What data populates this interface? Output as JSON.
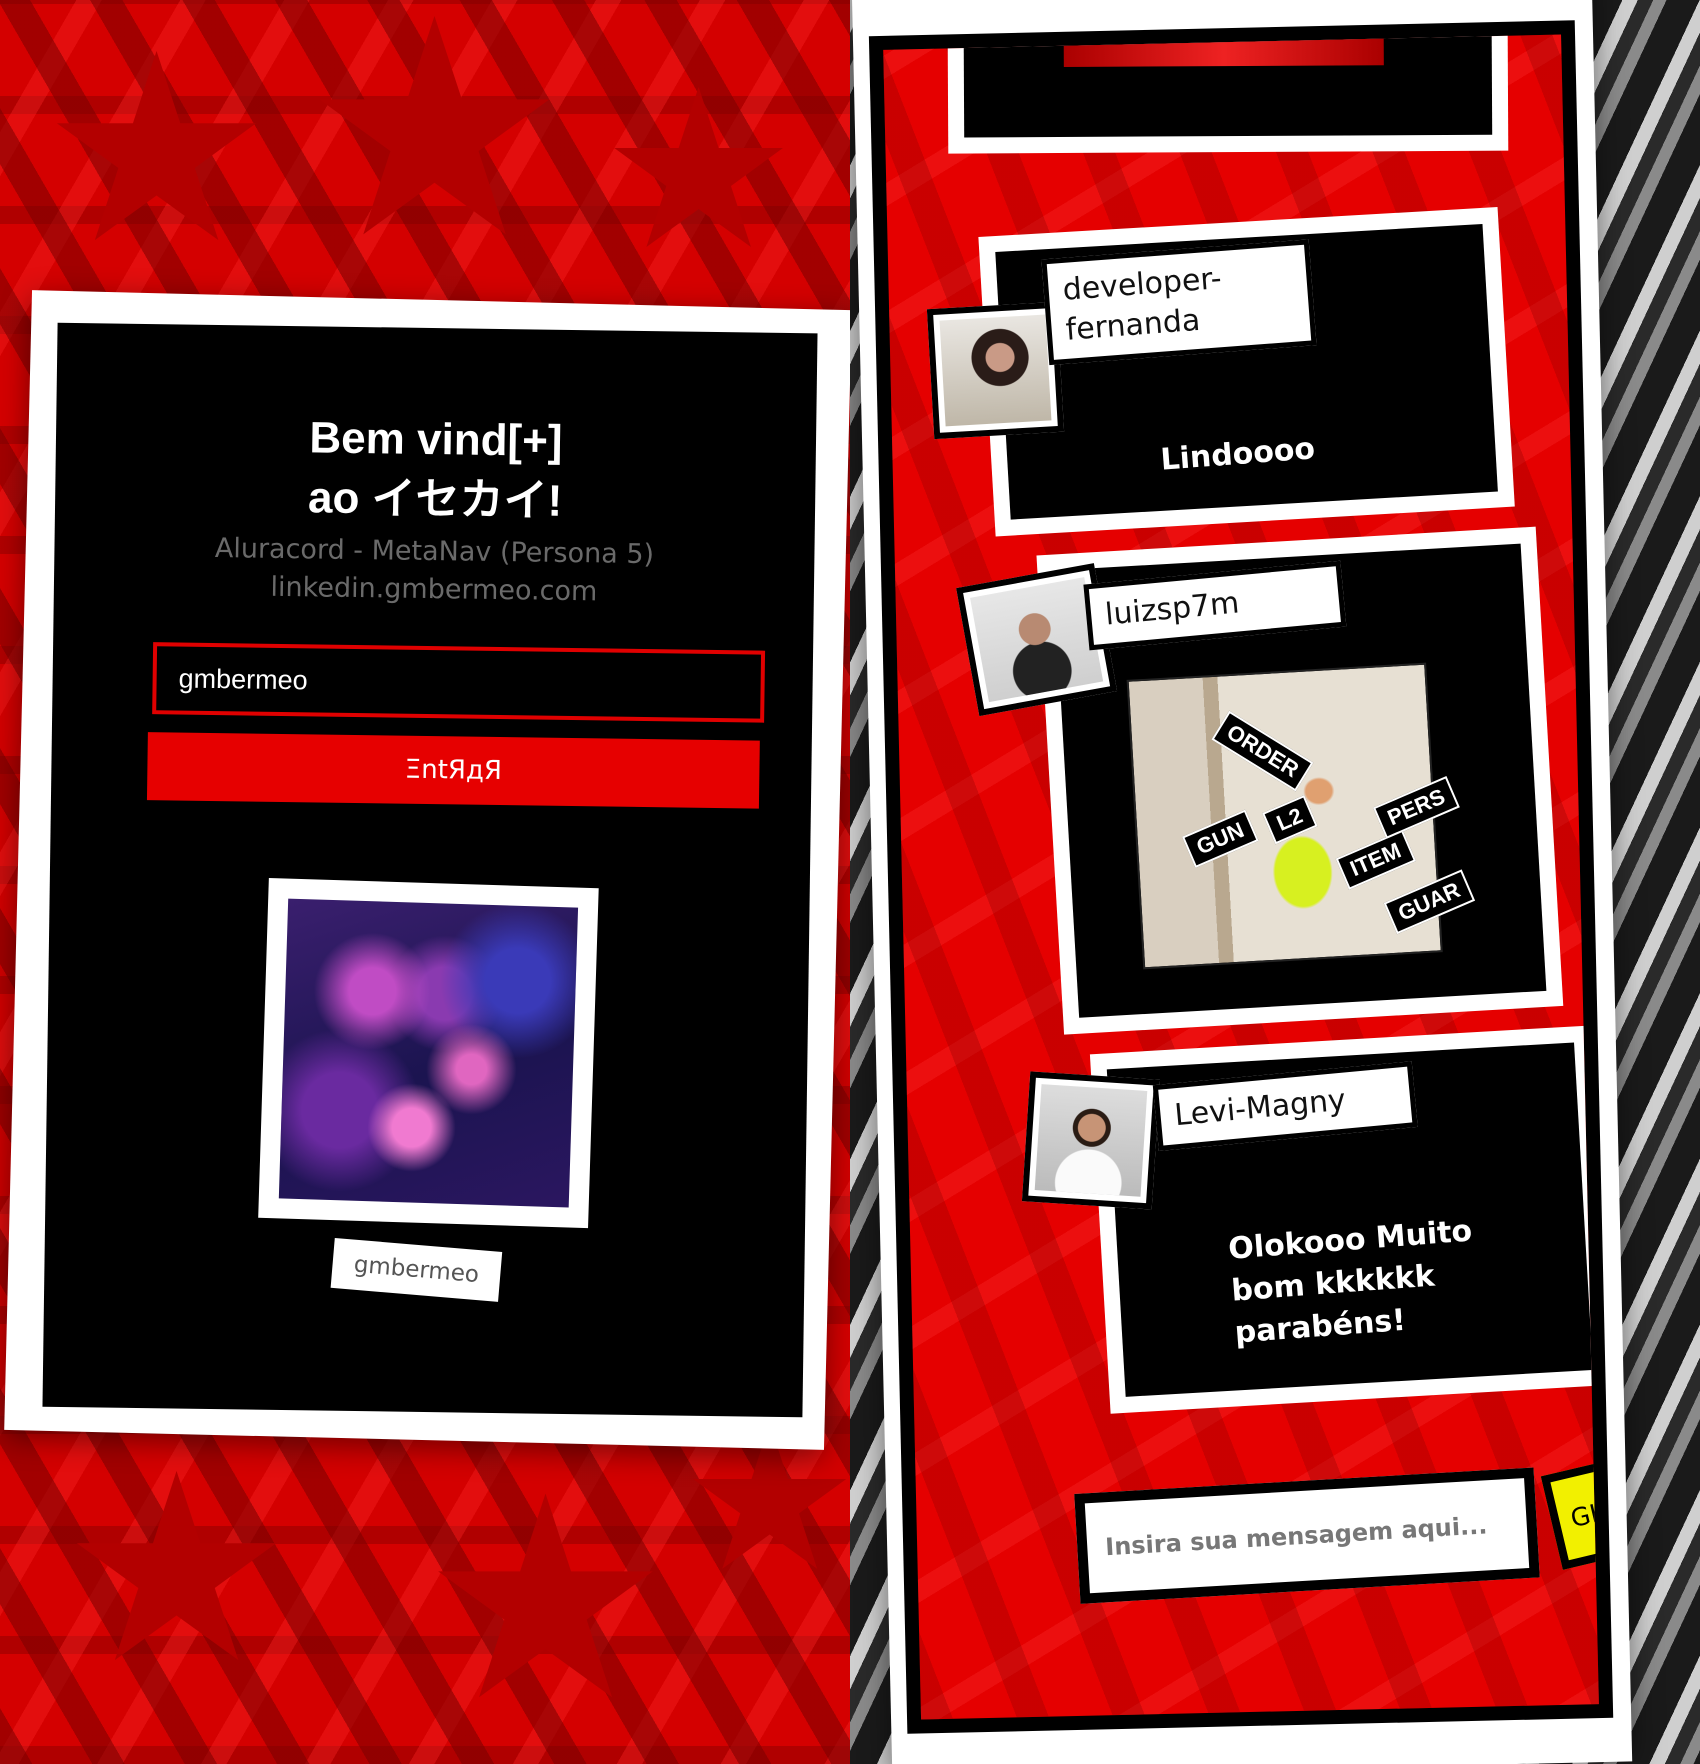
{
  "login": {
    "title_line1": "Bem vind[+]",
    "title_line2": "ao イセカイ!",
    "subtitle_line1": "Aluracord - MetaNav (Persona 5)",
    "subtitle_line2": "linkedin.gmbermeo.com",
    "username_value": "gmbermeo",
    "enter_label": "ΞntЯдЯ",
    "avatar_caption": "gmbermeo"
  },
  "chat": {
    "messages": [
      {
        "author": "developer-fernanda",
        "text": "Lindoooo"
      },
      {
        "author": "luizsp7m",
        "gif_labels": [
          "ORDER",
          "L2",
          "GUN",
          "ITEM",
          "PERS",
          "GUAR"
        ]
      },
      {
        "author": "Levi-Magny",
        "text_line1": "Olokooo Muito",
        "text_line2": "bom kkkkkk",
        "text_line3": "parabéns!"
      }
    ],
    "input_placeholder": "Insira sua mensagem aqui...",
    "gifs_label": "GIFS"
  },
  "colors": {
    "persona_red": "#e50000",
    "card_black": "#000000",
    "card_white": "#ffffff",
    "gifs_yellow": "#f2f000"
  }
}
